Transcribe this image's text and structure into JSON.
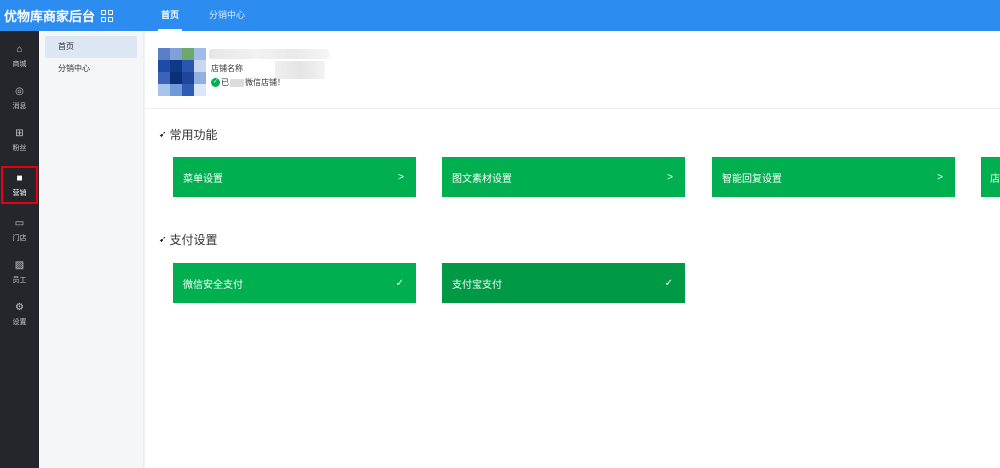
{
  "app": {
    "title": "优物库商家后台",
    "grid_icon": "grid-icon"
  },
  "top_tabs": [
    {
      "label": "首页",
      "active": true
    },
    {
      "label": "分销中心",
      "active": false
    }
  ],
  "rail": [
    {
      "label": "商城",
      "icon": "home-icon",
      "glyph": "⌂"
    },
    {
      "label": "消息",
      "icon": "message-icon",
      "glyph": "◎"
    },
    {
      "label": "粉丝",
      "icon": "fans-icon",
      "glyph": "⊞"
    },
    {
      "label": "营销",
      "icon": "marketing-icon",
      "glyph": "■",
      "active": true
    },
    {
      "label": "门店",
      "icon": "store-icon",
      "glyph": "▭"
    },
    {
      "label": "员工",
      "icon": "staff-icon",
      "glyph": "▨"
    },
    {
      "label": "设置",
      "icon": "settings-icon",
      "glyph": "⚙"
    }
  ],
  "subnav": [
    {
      "label": "首页",
      "active": true
    },
    {
      "label": "分销中心",
      "active": false
    }
  ],
  "store": {
    "name_label": "店铺名称",
    "status_prefix": "已",
    "status_suffix": "微信店铺！"
  },
  "sections": {
    "common": {
      "title": "常用功能",
      "cards": [
        {
          "label": "菜单设置",
          "arrow": ">"
        },
        {
          "label": "图文素材设置",
          "arrow": ">"
        },
        {
          "label": "智能回复设置",
          "arrow": ">"
        },
        {
          "label": "店",
          "arrow": ""
        }
      ]
    },
    "pay": {
      "title": "支付设置",
      "cards": [
        {
          "label": "微信安全支付",
          "mark": "✓"
        },
        {
          "label": "支付宝支付",
          "mark": "✓"
        }
      ]
    }
  },
  "colors": {
    "topbar": "#2d8cf0",
    "rail": "#25262b",
    "card_green": "#00b050",
    "card_green_dark": "#009a47",
    "highlight": "#e60012"
  }
}
